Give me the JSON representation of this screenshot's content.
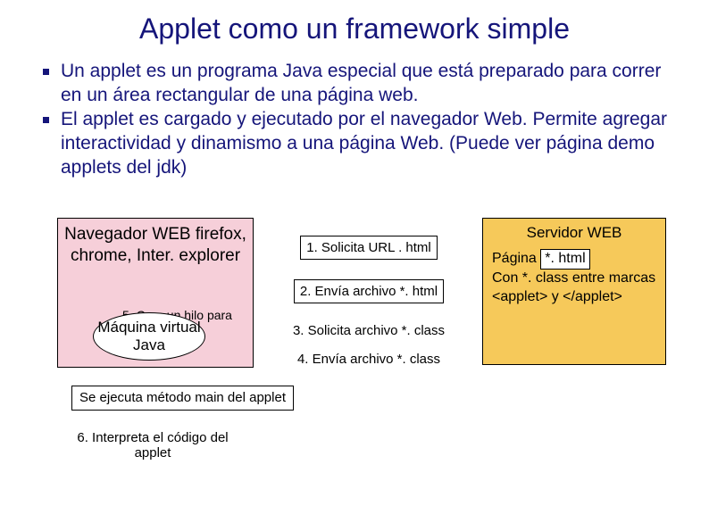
{
  "title": "Applet como un framework simple",
  "bullets": [
    "Un applet es un programa Java especial que está preparado para correr en un área rectangular de una página web.",
    "El applet es cargado y ejecutado por el navegador Web. Permite agregar interactividad y dinamismo a una página Web. (Puede ver página demo applets del jdk)"
  ],
  "browser": {
    "label": "Navegador WEB firefox, chrome, Inter. explorer",
    "step5": "5. Crea un hilo para MVJ",
    "jvm": "Máquina virtual Java"
  },
  "exec_box": "Se ejecuta método main del applet",
  "step6": "6. Interpreta el código del applet",
  "steps": {
    "s1": "1. Solicita URL . html",
    "s2": "2. Envía archivo *. html",
    "s3": "3. Solicita archivo *. class",
    "s4": "4. Envía archivo  *. class"
  },
  "server": {
    "label": "Servidor WEB",
    "line1a": "Página",
    "line1b": "*. html",
    "line2": "Con *. class entre marcas <applet> y </applet>"
  }
}
